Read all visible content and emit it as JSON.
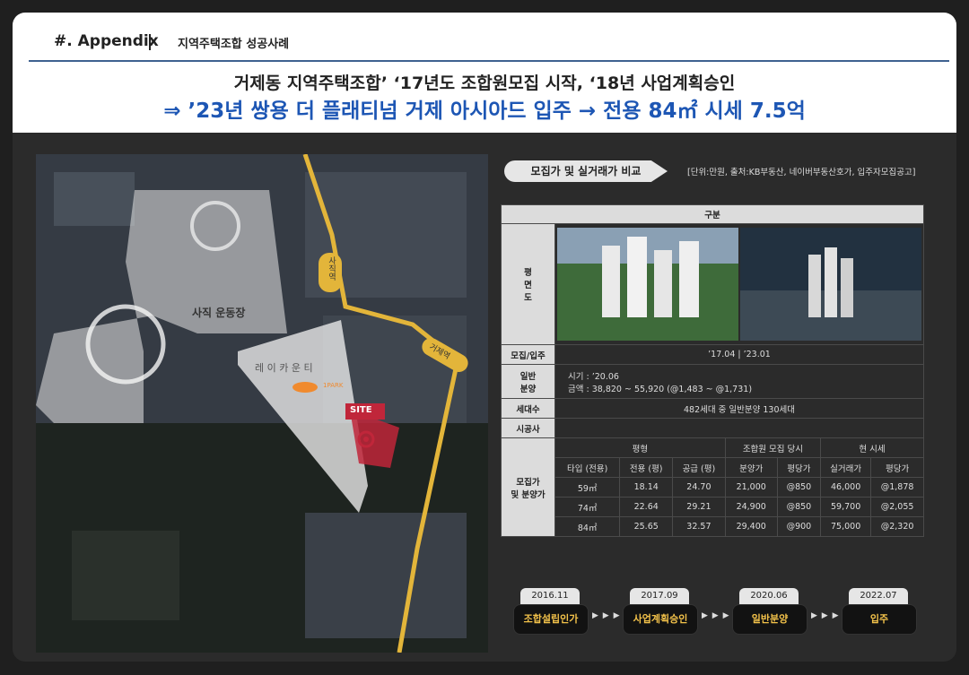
{
  "header": {
    "section": "#.  Appendix",
    "subtitle": "지역주택조합 성공사례",
    "line1": "거제동 지역주택조합’ ‘17년도 조합원모집 시작, ‘18년 사업계획승인",
    "line2": "⇒ ’23년  쌍용 더 플래티넘 거제 아시아드 입주 → 전용 84㎡ 시세 7.5억"
  },
  "map": {
    "stadium_label": "사직 운동장",
    "area_label": "레 이 카 운 티",
    "site_label": "SITE",
    "park_label": "1PARK",
    "station1": "사직역",
    "station2": "거제역",
    "colors": {
      "rail": "#e3b53a",
      "site": "#c0263a",
      "area": "#e8e8e8"
    }
  },
  "compare": {
    "tab_label": "모집가 및 실거래가 비교",
    "note": "[단위:만원, 출처:KB부동산, 네이버부동산호가, 입주자모집공고]",
    "header": "구분",
    "plan_label": "평\n면\n도",
    "recruit_label": "모집/입주",
    "recruit_value": "’17.04 | ’23.01",
    "sale_label": "일반\n분양",
    "sale_period": "시기 : ’20.06",
    "sale_price": "금액 : 38,820 ~ 55,920 (@1,483 ~ @1,731)",
    "households_label": "세대수",
    "households_value": "482세대 중 일반분양 130세대",
    "builder_label": "시공사",
    "builder_value": "",
    "price_label": "모집가\n및 분양가",
    "group_headers": [
      "평형",
      "조합원 모집 당시",
      "현 시세"
    ],
    "sub_headers": [
      "타입 (전용)",
      "전용 (평)",
      "공급 (평)",
      "분양가",
      "평당가",
      "실거래가",
      "평당가"
    ],
    "rows": [
      [
        "59㎡",
        "18.14",
        "24.70",
        "21,000",
        "@850",
        "46,000",
        "@1,878"
      ],
      [
        "74㎡",
        "22.64",
        "29.21",
        "24,900",
        "@850",
        "59,700",
        "@2,055"
      ],
      [
        "84㎡",
        "25.65",
        "32.57",
        "29,400",
        "@900",
        "75,000",
        "@2,320"
      ]
    ]
  },
  "timeline": [
    {
      "date": "2016.11",
      "event": "조합설립인가"
    },
    {
      "date": "2017.09",
      "event": "사업계획승인"
    },
    {
      "date": "2020.06",
      "event": "일반분양"
    },
    {
      "date": "2022.07",
      "event": "입주"
    }
  ],
  "timeline_arrow": "▶ ▶ ▶"
}
